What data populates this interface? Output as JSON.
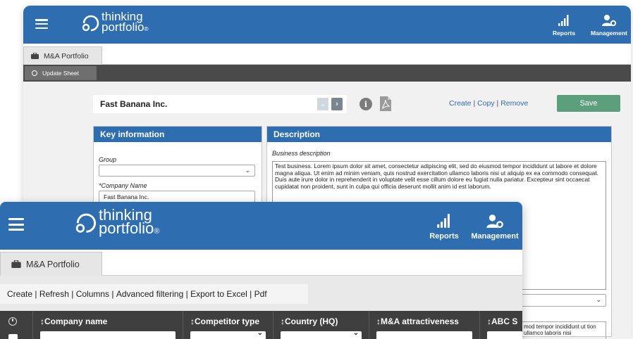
{
  "back_window": {
    "brand_line1": "thinking",
    "brand_line2": "portfolio",
    "brand_reg": "®",
    "nav": {
      "reports": "Reports",
      "management": "Management"
    },
    "tab_label": "M&A Portfolio",
    "update_sheet": "Update Sheet",
    "company_select": "Fast Banana Inc.",
    "actions": {
      "create": "Create",
      "copy": "Copy",
      "remove": "Remove",
      "sep": "|"
    },
    "save": "Save",
    "key_info": {
      "title": "Key information",
      "group_label": "Group",
      "company_label": "*Company Name",
      "company_value": "Fast Banana Inc."
    },
    "description": {
      "title": "Description",
      "business_label": "Business description",
      "business_text": "Test business. Lorem ipsum dolor sit amet, consectetur adipiscing elit, sed do eiusmod tempor incididunt ut labore et dolore magna aliqua. Ut enim ad minim veniam, quis nostrud exercitation ullamco laboris nisi ut aliquip ex ea commodo consequat. Duis aute irure dolor in reprehenderit in voluptate velit esse cillum dolore eu fugiat nulla pariatur. Excepteur sint occaecat cupidatat non proident, sunt in culpa qui officia deserunt mollit anim id est laborum.",
      "second_text": "mod tempor incididunt ut tion ullamco laboris nisi"
    }
  },
  "front_window": {
    "brand_line1": "thinking",
    "brand_line2": "portfolio",
    "brand_reg": "®",
    "nav": {
      "reports": "Reports",
      "management": "Management"
    },
    "tab_label": "M&A Portfolio",
    "toolbar": {
      "create": "Create",
      "refresh": "Refresh",
      "columns": "Columns",
      "advanced_filtering": "Advanced filtering",
      "export_excel": "Export to Excel",
      "pdf": "Pdf",
      "sep": "|"
    },
    "columns": [
      {
        "label": "↕Company name"
      },
      {
        "label": "↕Competitor type"
      },
      {
        "label": "↕Country (HQ)"
      },
      {
        "label": "↕M&A attractiveness"
      },
      {
        "label": "↕ABC S"
      }
    ]
  },
  "colors": {
    "header_blue": "#2d6db0",
    "save_green": "#5c9f7c",
    "grid_header": "#3f3f3f",
    "dark_bar": "#4a4a4a"
  },
  "icons": [
    "menu-icon",
    "logo-icon",
    "signal-bars-icon",
    "user-gear-icon",
    "briefcase-icon",
    "radio-icon",
    "chevron-down-icon",
    "chevron-right-icon",
    "info-icon",
    "pdf-icon",
    "clock-icon",
    "checkbox-icon",
    "sort-icon"
  ]
}
